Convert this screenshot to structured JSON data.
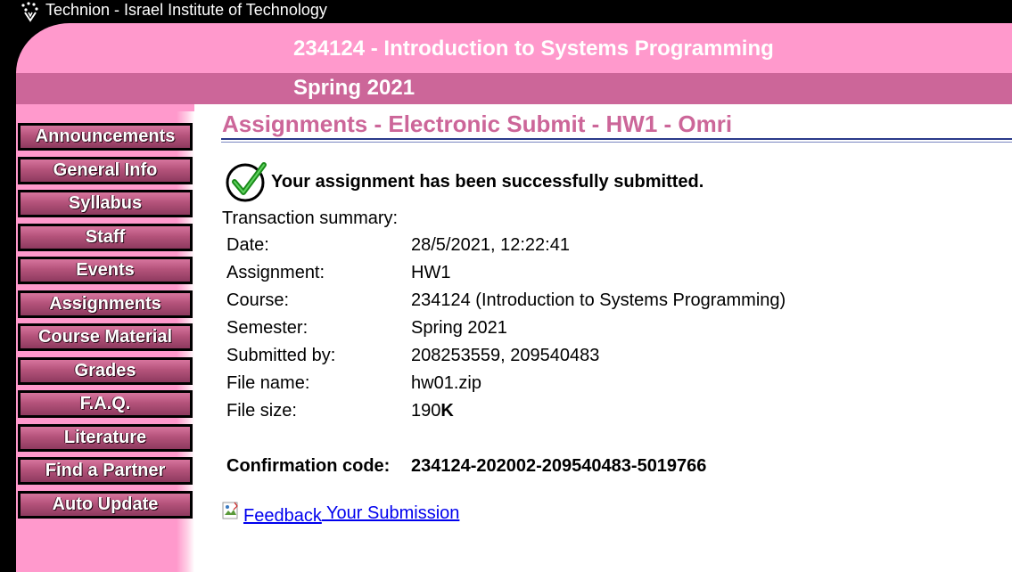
{
  "header": {
    "institution": "Technion - Israel Institute of Technology",
    "course_title": "234124 - Introduction to Systems Programming",
    "semester": "Spring 2021"
  },
  "sidebar": {
    "items": [
      {
        "label": "Announcements"
      },
      {
        "label": "General Info"
      },
      {
        "label": "Syllabus"
      },
      {
        "label": "Staff"
      },
      {
        "label": "Events"
      },
      {
        "label": "Assignments"
      },
      {
        "label": "Course Material"
      },
      {
        "label": "Grades"
      },
      {
        "label": "F.A.Q."
      },
      {
        "label": "Literature"
      },
      {
        "label": "Find a Partner"
      },
      {
        "label": "Auto Update"
      }
    ]
  },
  "main": {
    "heading": "Assignments - Electronic Submit - HW1 - Omri",
    "success_message": "Your assignment has been successfully submitted.",
    "summary_title": "Transaction summary:",
    "summary": [
      {
        "label": "Date:",
        "value": "28/5/2021, 12:22:41"
      },
      {
        "label": "Assignment:",
        "value": "HW1"
      },
      {
        "label": "Course:",
        "value": "234124 (Introduction to Systems Programming)"
      },
      {
        "label": "Semester:",
        "value": "Spring 2021"
      },
      {
        "label": "Submitted by:",
        "value": "208253559, 209540483"
      },
      {
        "label": "File name:",
        "value": "hw01.zip"
      },
      {
        "label": "File size:",
        "value": "190",
        "unit": "K"
      }
    ],
    "confirmation_label": "Confirmation code:",
    "confirmation_code": "234124-202002-209540483-5019766",
    "feedback_img_alt": "Feedback",
    "feedback_text": " Your Submission"
  },
  "colors": {
    "header_light": "#ff99cc",
    "header_dark": "#cc6699",
    "heading_text": "#cc6699",
    "link": "#0000ee"
  },
  "icons": {
    "logo": "technion-logo-icon",
    "success": "checkmark-circle-icon",
    "broken_image": "broken-image-icon"
  }
}
